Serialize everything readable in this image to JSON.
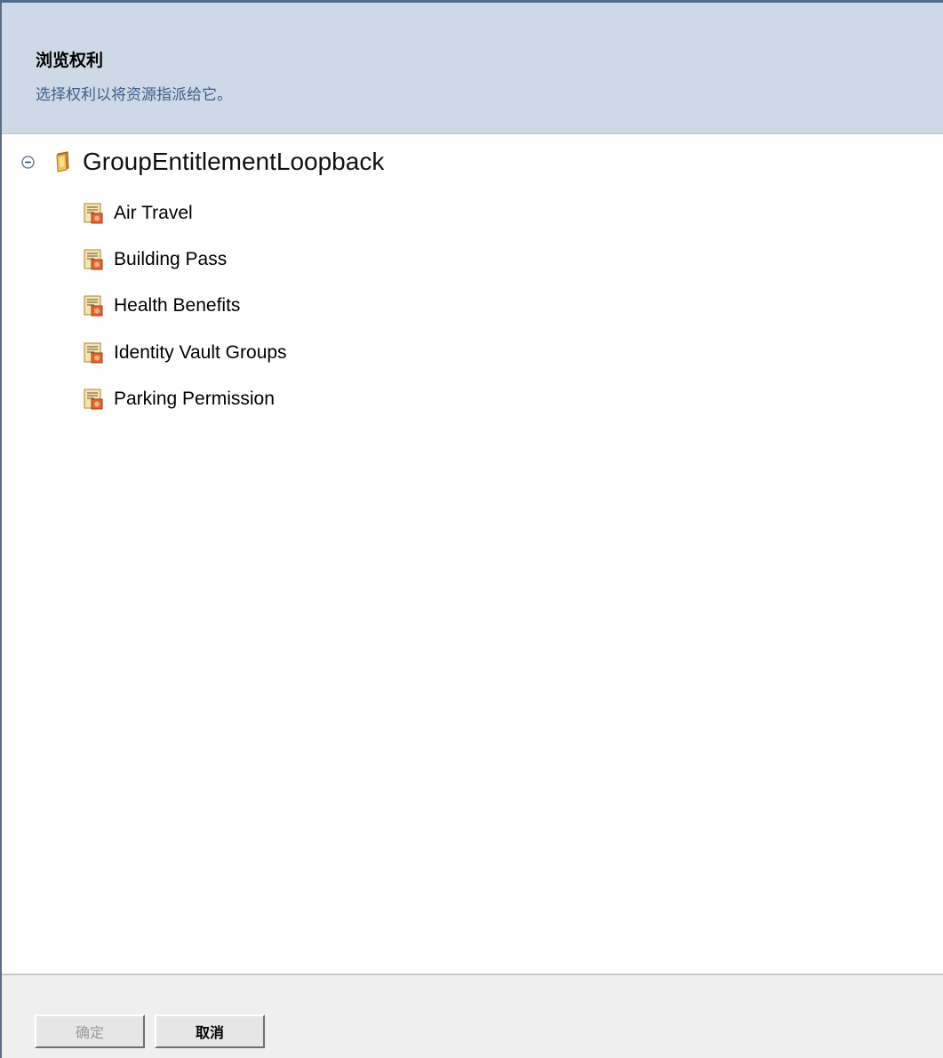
{
  "header": {
    "title": "浏览权利",
    "subtitle": "选择权利以将资源指派给它。"
  },
  "tree": {
    "root": {
      "label": "GroupEntitlementLoopback",
      "expanded": true,
      "toggle_icon": "collapse-minus-icon",
      "icon": "driver-folder-icon"
    },
    "items": [
      {
        "label": "Air Travel",
        "icon": "entitlement-icon"
      },
      {
        "label": "Building Pass",
        "icon": "entitlement-icon"
      },
      {
        "label": "Health Benefits",
        "icon": "entitlement-icon"
      },
      {
        "label": "Identity Vault Groups",
        "icon": "entitlement-icon"
      },
      {
        "label": "Parking Permission",
        "icon": "entitlement-icon"
      }
    ]
  },
  "footer": {
    "ok_label": "确定",
    "ok_enabled": false,
    "cancel_label": "取消"
  },
  "colors": {
    "header_bg": "#cdd9e6",
    "subtitle": "#3d5f85",
    "footer_bg": "#efefef"
  }
}
